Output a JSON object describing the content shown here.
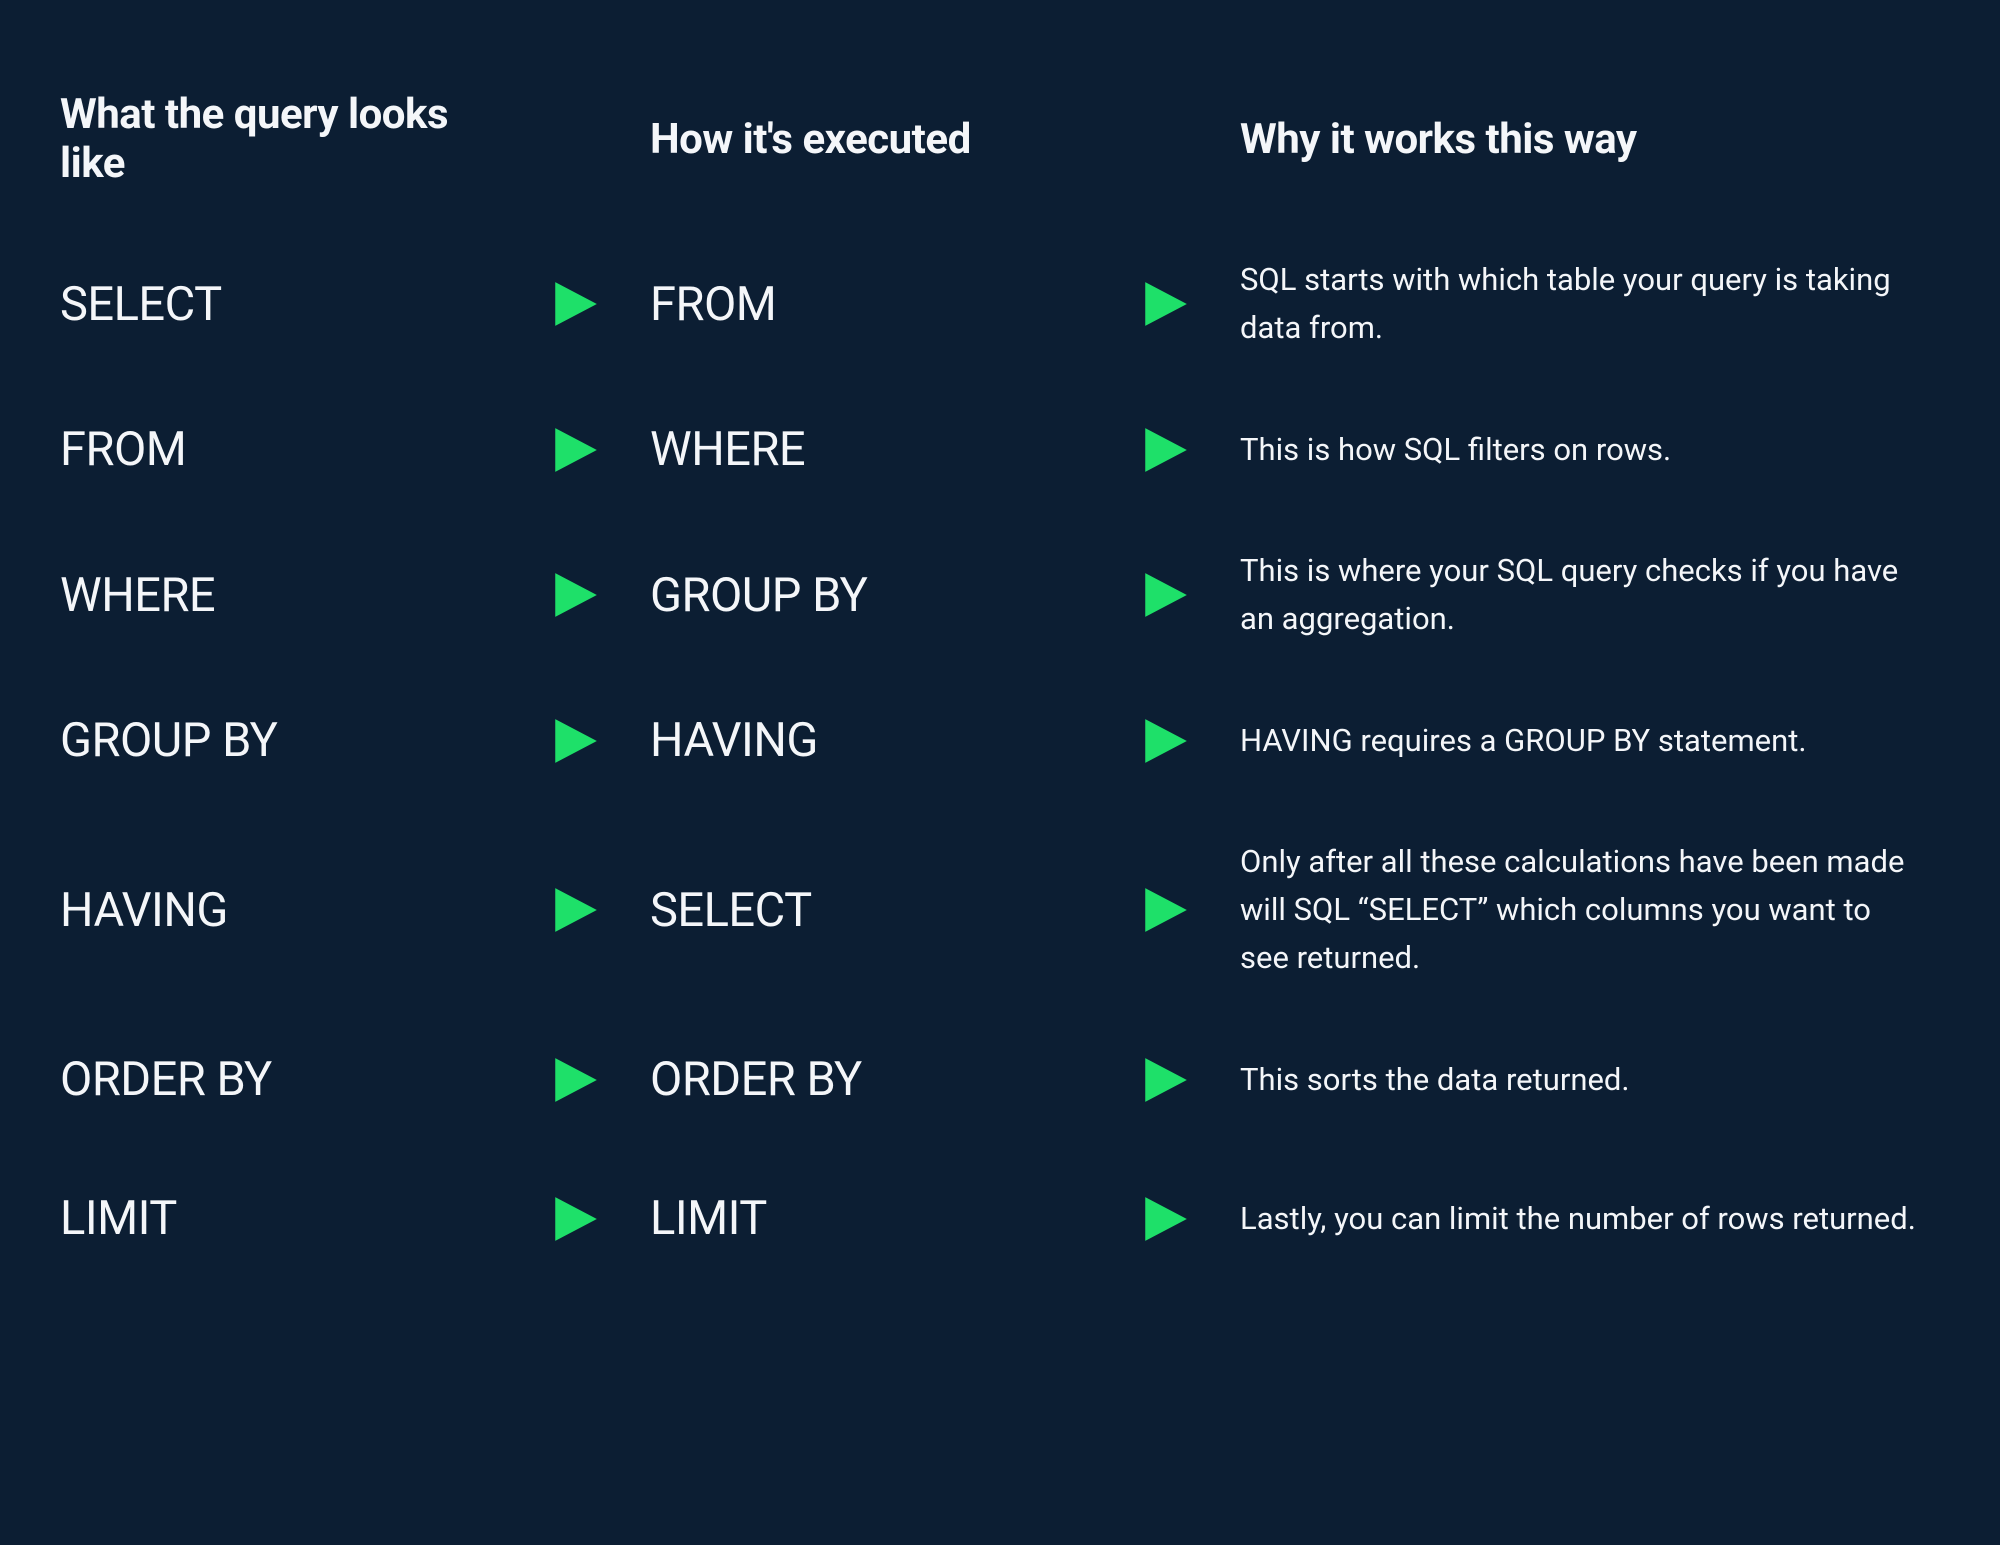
{
  "headers": {
    "written": "What the query looks like",
    "executed": "How it's executed",
    "why": "Why it works this way"
  },
  "rows": [
    {
      "written": "SELECT",
      "executed": "FROM",
      "why": "SQL starts with which table your query is taking data from."
    },
    {
      "written": "FROM",
      "executed": "WHERE",
      "why": "This is how SQL filters on rows."
    },
    {
      "written": "WHERE",
      "executed": "GROUP BY",
      "why": "This is where your SQL query checks if you have an aggregation."
    },
    {
      "written": "GROUP BY",
      "executed": "HAVING",
      "why": "HAVING requires a GROUP BY statement."
    },
    {
      "written": "HAVING",
      "executed": "SELECT",
      "why": "Only after all these calculations have been made will SQL “SELECT” which columns you want to see returned."
    },
    {
      "written": "ORDER BY",
      "executed": "ORDER BY",
      "why": "This sorts the data returned."
    },
    {
      "written": "LIMIT",
      "executed": "LIMIT",
      "why": "Lastly, you can limit the number of rows returned."
    }
  ],
  "arrow_color": "#1ee069"
}
